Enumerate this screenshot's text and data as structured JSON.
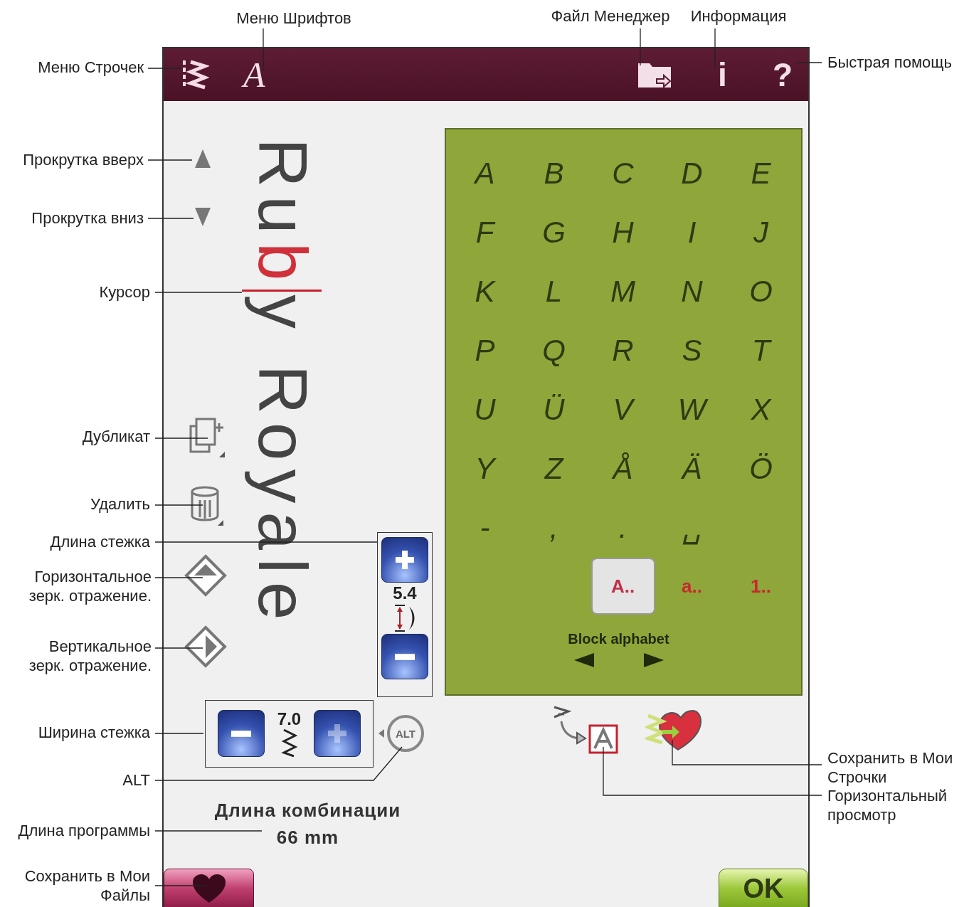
{
  "callouts": [
    {
      "text": "Меню Шрифтов"
    },
    {
      "text": "Файл Менеджер"
    },
    {
      "text": "Информация"
    },
    {
      "text": "Меню Строчек"
    },
    {
      "text": "Быстрая помощь"
    },
    {
      "text": "Прокрутка вверх"
    },
    {
      "text": "Прокрутка вниз"
    },
    {
      "text": "Курсор"
    },
    {
      "text": "Дубликат"
    },
    {
      "text": "Удалить"
    },
    {
      "text": "Длина стежка"
    },
    {
      "text": "Горизонтальное\nзерк. отражение."
    },
    {
      "text": "Вертикальное\nзерк. отражение."
    },
    {
      "text": "Ширина стежка"
    },
    {
      "text": "ALT"
    },
    {
      "text": "Сохранить в Мои\nСтрочки"
    },
    {
      "text": "Горизонтальный\nпросмотр"
    },
    {
      "text": "Длина программы"
    },
    {
      "text": "Сохранить в Мои\nФайлы"
    }
  ],
  "top_bar": {
    "font_menu": "A",
    "info": "i",
    "help": "?"
  },
  "preview": {
    "parts": [
      {
        "text": "Ru",
        "selected": false
      },
      {
        "text": "b",
        "selected": true
      },
      {
        "text": "y Royale",
        "selected": false
      }
    ]
  },
  "stitch_length": {
    "value": "5.4"
  },
  "stitch_width": {
    "value": "7.0"
  },
  "alt_button": {
    "label": "ALT"
  },
  "alphabet": {
    "letters": [
      "A",
      "B",
      "C",
      "D",
      "E",
      "F",
      "G",
      "H",
      "I",
      "J",
      "K",
      "L",
      "M",
      "N",
      "O",
      "P",
      "Q",
      "R",
      "S",
      "T",
      "U",
      "Ü",
      "V",
      "W",
      "X",
      "Y",
      "Z",
      "Å",
      "Ä",
      "Ö",
      "-",
      ",",
      ".",
      "␣"
    ],
    "tabs": [
      {
        "label": "A..",
        "selected": true
      },
      {
        "label": "a..",
        "selected": false
      },
      {
        "label": "1..",
        "selected": false
      }
    ],
    "font_name": "Block alphabet"
  },
  "program_length": {
    "label": "Длина комбинации",
    "value": "66 mm"
  },
  "ok_button": {
    "label": "OK"
  }
}
